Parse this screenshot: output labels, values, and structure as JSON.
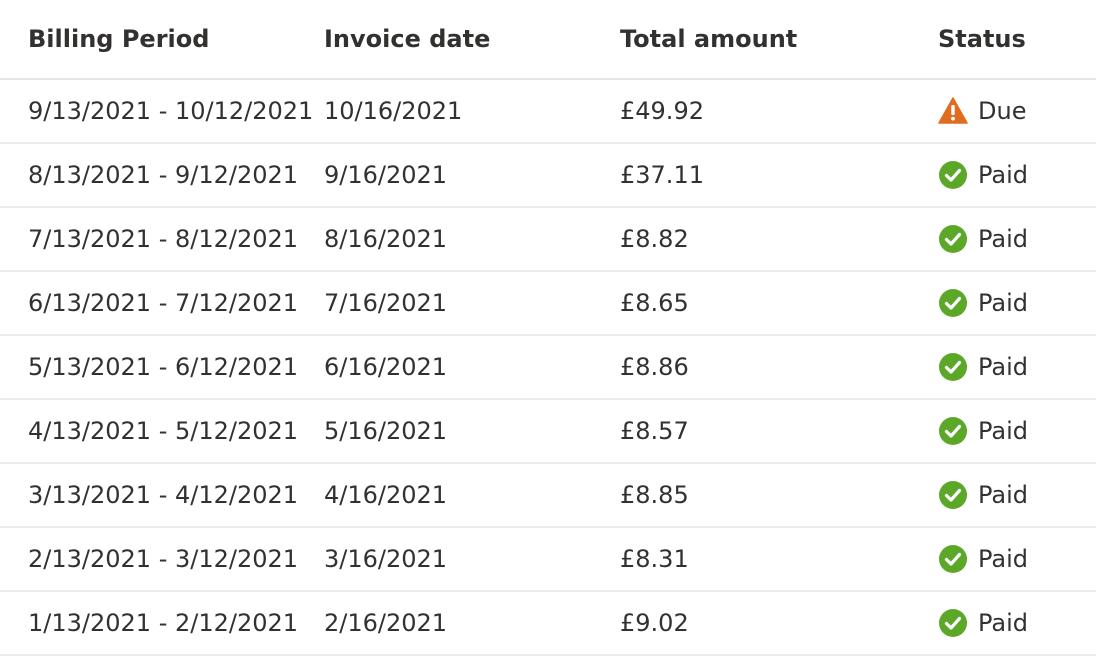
{
  "table": {
    "headers": {
      "billing_period": "Billing Period",
      "invoice_date": "Invoice date",
      "total_amount": "Total amount",
      "status": "Status"
    },
    "rows": [
      {
        "billing_period": "9/13/2021 - 10/12/2021",
        "invoice_date": "10/16/2021",
        "total_amount": "£49.92",
        "status": "Due",
        "status_icon": "warning-icon"
      },
      {
        "billing_period": "8/13/2021 - 9/12/2021",
        "invoice_date": "9/16/2021",
        "total_amount": "£37.11",
        "status": "Paid",
        "status_icon": "check-circle-icon"
      },
      {
        "billing_period": "7/13/2021 - 8/12/2021",
        "invoice_date": "8/16/2021",
        "total_amount": "£8.82",
        "status": "Paid",
        "status_icon": "check-circle-icon"
      },
      {
        "billing_period": "6/13/2021 - 7/12/2021",
        "invoice_date": "7/16/2021",
        "total_amount": "£8.65",
        "status": "Paid",
        "status_icon": "check-circle-icon"
      },
      {
        "billing_period": "5/13/2021 - 6/12/2021",
        "invoice_date": "6/16/2021",
        "total_amount": "£8.86",
        "status": "Paid",
        "status_icon": "check-circle-icon"
      },
      {
        "billing_period": "4/13/2021 - 5/12/2021",
        "invoice_date": "5/16/2021",
        "total_amount": "£8.57",
        "status": "Paid",
        "status_icon": "check-circle-icon"
      },
      {
        "billing_period": "3/13/2021 - 4/12/2021",
        "invoice_date": "4/16/2021",
        "total_amount": "£8.85",
        "status": "Paid",
        "status_icon": "check-circle-icon"
      },
      {
        "billing_period": "2/13/2021 - 3/12/2021",
        "invoice_date": "3/16/2021",
        "total_amount": "£8.31",
        "status": "Paid",
        "status_icon": "check-circle-icon"
      },
      {
        "billing_period": "1/13/2021 - 2/12/2021",
        "invoice_date": "2/16/2021",
        "total_amount": "£9.02",
        "status": "Paid",
        "status_icon": "check-circle-icon"
      }
    ]
  },
  "colors": {
    "paid": "#5ba829",
    "due": "#e06c1d",
    "text": "#323130",
    "divider": "#ececec"
  }
}
